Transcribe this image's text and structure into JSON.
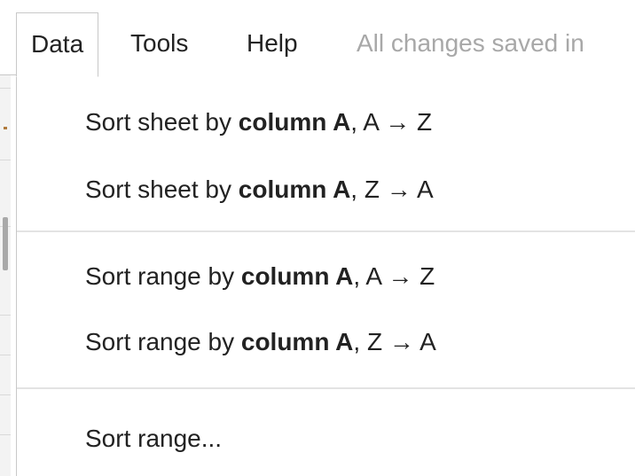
{
  "menubar": {
    "items": [
      {
        "label": "Data",
        "active": true
      },
      {
        "label": "Tools",
        "active": false
      },
      {
        "label": "Help",
        "active": false
      }
    ],
    "status": "All changes saved in"
  },
  "data_menu": {
    "sort_sheet_az": {
      "prefix": "Sort sheet by ",
      "bold": "column A",
      "suffix": ", A → Z"
    },
    "sort_sheet_za": {
      "prefix": "Sort sheet by ",
      "bold": "column A",
      "suffix": ", Z → A"
    },
    "sort_range_az": {
      "prefix": "Sort range by ",
      "bold": "column A",
      "suffix": ", A → Z"
    },
    "sort_range_za": {
      "prefix": "Sort range by ",
      "bold": "column A",
      "suffix": ", Z → A"
    },
    "sort_range_dialog": "Sort range..."
  }
}
